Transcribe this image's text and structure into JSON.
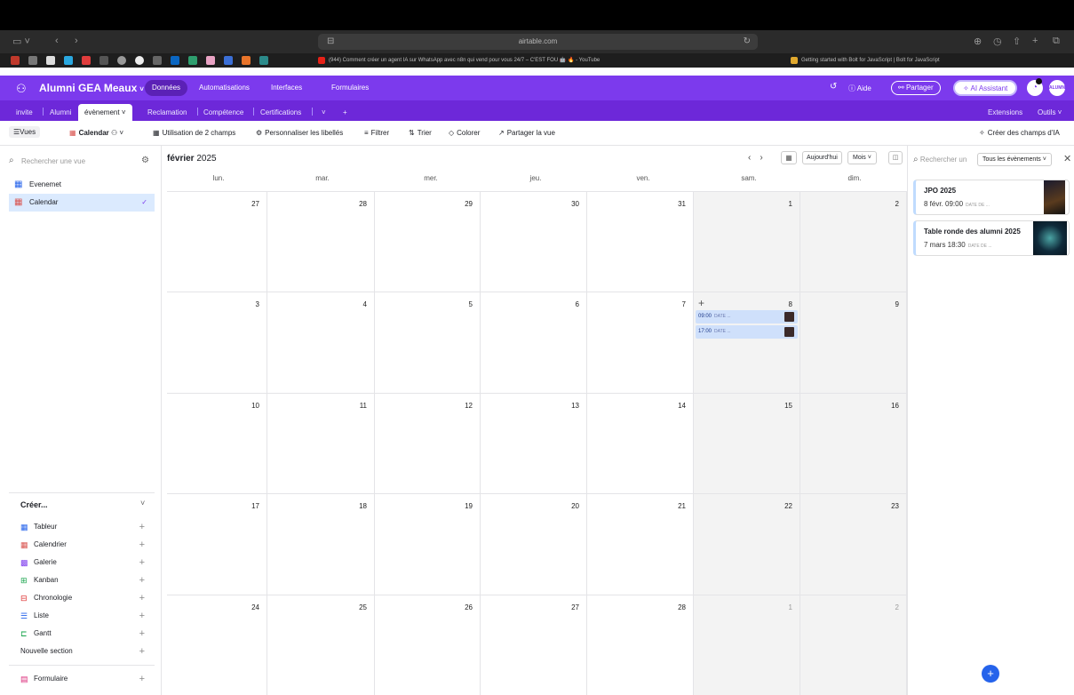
{
  "browser": {
    "url": "airtable.com",
    "tabs": [
      {
        "title": "(944) Comment créer un agent IA sur WhatsApp avec n8n qui vend pour vous 24/7 – C'EST FOU 🤖 🔥 - YouTube"
      },
      {
        "title": "Getting started with Bolt for JavaScript | Bolt for JavaScript"
      }
    ]
  },
  "header": {
    "base_name": "Alumni GEA Meaux",
    "nav": [
      "Données",
      "Automatisations",
      "Interfaces",
      "Formulaires"
    ],
    "help": "Aide",
    "share": "Partager",
    "ai_assistant": "AI Assistant",
    "avatar": "ALUMNI"
  },
  "tables": {
    "items": [
      "invite",
      "Alumni",
      "évènement",
      "Reclamation",
      "Compétence",
      "Certifications"
    ],
    "extensions": "Extensions",
    "tools": "Outils"
  },
  "toolbar": {
    "views": "Vues",
    "calendar": "Calendar",
    "date_fields": "Utilisation de 2 champs",
    "customize_labels": "Personnaliser les libellés",
    "filter": "Filtrer",
    "sort": "Trier",
    "color": "Colorer",
    "share_view": "Partager la vue",
    "ai_fields": "Créer des champs d'IA"
  },
  "sidebar": {
    "search_placeholder": "Rechercher une vue",
    "views": [
      {
        "label": "Evenemet",
        "icon": "grid-icon"
      },
      {
        "label": "Calendar",
        "icon": "calendar-icon"
      }
    ],
    "create_title": "Créer...",
    "create_items": [
      {
        "label": "Tableur",
        "icon": "grid-icon"
      },
      {
        "label": "Calendrier",
        "icon": "calendar-icon"
      },
      {
        "label": "Galerie",
        "icon": "gallery-icon"
      },
      {
        "label": "Kanban",
        "icon": "kanban-icon"
      },
      {
        "label": "Chronologie",
        "icon": "timeline-icon"
      },
      {
        "label": "Liste",
        "icon": "list-icon"
      },
      {
        "label": "Gantt",
        "icon": "gantt-icon"
      },
      {
        "label": "Nouvelle section",
        "icon": ""
      }
    ],
    "form": "Formulaire"
  },
  "calendar": {
    "month": "février",
    "year": "2025",
    "today": "Aujourd'hui",
    "mode": "Mois",
    "days_of_week": [
      "lun.",
      "mar.",
      "mer.",
      "jeu.",
      "ven.",
      "sam.",
      "dim."
    ],
    "weeks": [
      [
        "27",
        "28",
        "29",
        "30",
        "31",
        "1",
        "2"
      ],
      [
        "3",
        "4",
        "5",
        "6",
        "7",
        "8",
        "9"
      ],
      [
        "10",
        "11",
        "12",
        "13",
        "14",
        "15",
        "16"
      ],
      [
        "17",
        "18",
        "19",
        "20",
        "21",
        "22",
        "23"
      ],
      [
        "24",
        "25",
        "26",
        "27",
        "28",
        "1",
        "2"
      ]
    ],
    "events": [
      {
        "time": "09:00",
        "label": "DATE ..."
      },
      {
        "time": "17:00",
        "label": "DATE ..."
      }
    ]
  },
  "panel": {
    "search_placeholder": "Rechercher un",
    "filter": "Tous les évènements",
    "cards": [
      {
        "title": "JPO 2025",
        "date": "8 févr. 09:00",
        "label": "DATE DE ..."
      },
      {
        "title": "Table ronde des alumni 2025",
        "date": "7 mars 18:30",
        "label": "DATE DE ..."
      }
    ]
  }
}
